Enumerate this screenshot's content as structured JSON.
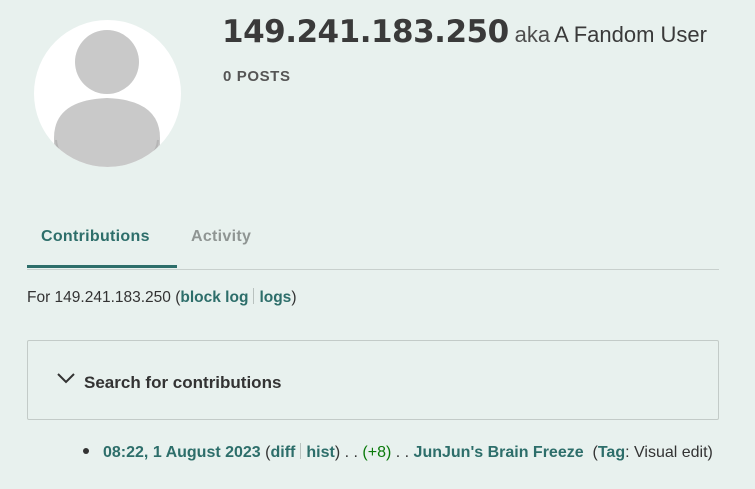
{
  "profile": {
    "username": "149.241.183.250",
    "aka_label": "aka",
    "aka_name": "A Fandom User",
    "posts": "0 POSTS"
  },
  "tabs": [
    {
      "label": "Contributions",
      "active": true
    },
    {
      "label": "Activity",
      "active": false
    }
  ],
  "for_line": {
    "prefix": "For 149.241.183.250 (",
    "block_log": "block log",
    "logs": "logs",
    "suffix": ")"
  },
  "search": {
    "title": "Search for contributions"
  },
  "contributions": [
    {
      "timestamp": "08:22, 1 August 2023",
      "diff": "diff",
      "hist": "hist",
      "dots1": ". .",
      "size_change": "(+8)",
      "dots2": ". .",
      "page": "JunJun's Brain Freeze",
      "tag_open": "(",
      "tag_label": "Tag",
      "tag_value": ": Visual edit",
      "tag_close": ")"
    }
  ],
  "colors": {
    "background": "#e8f1ee",
    "accent": "#2d6e6a",
    "positive_bytes": "#0a7a0a"
  }
}
